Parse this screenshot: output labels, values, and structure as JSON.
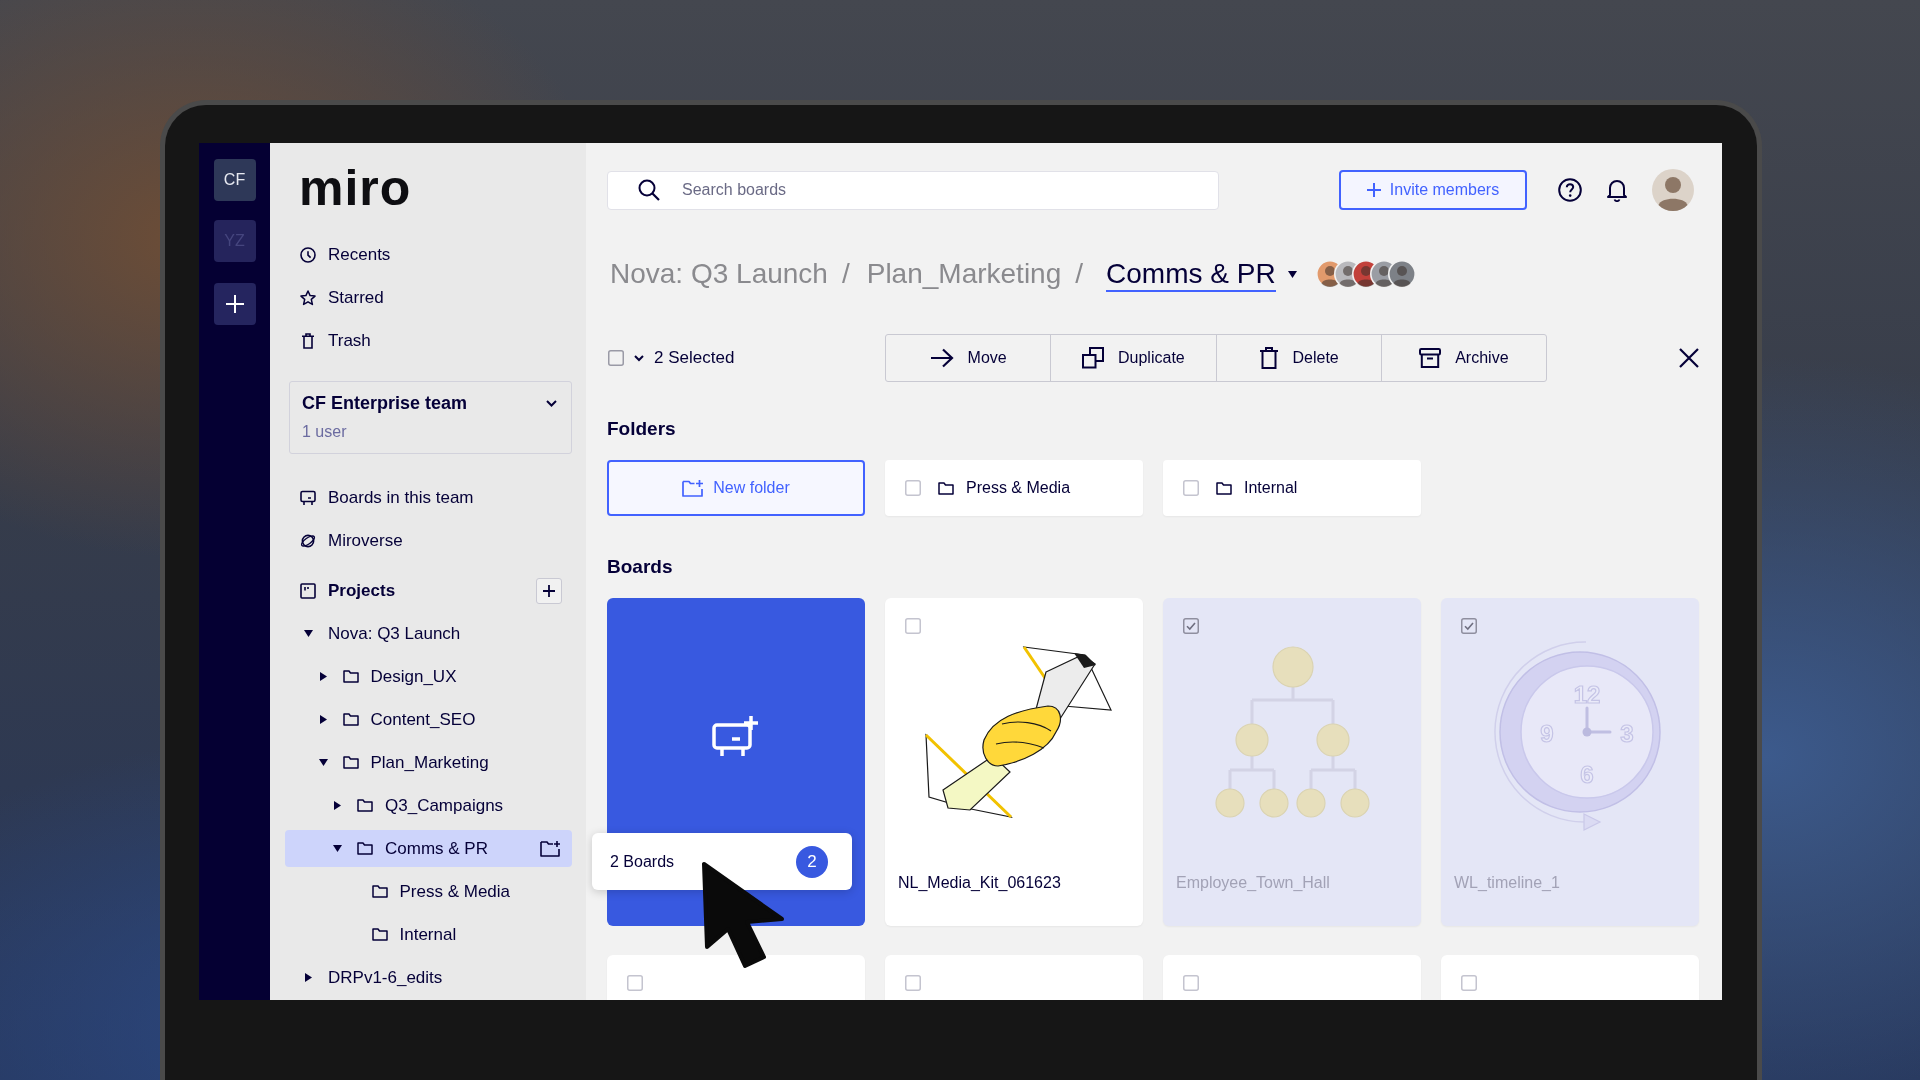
{
  "team_rail": {
    "teams": [
      {
        "initials": "CF",
        "selected": true
      },
      {
        "initials": "YZ",
        "selected": false
      }
    ]
  },
  "sidebar": {
    "logo": "miro",
    "nav": [
      {
        "label": "Recents"
      },
      {
        "label": "Starred"
      },
      {
        "label": "Trash"
      }
    ],
    "team": {
      "name": "CF Enterprise team",
      "members": "1 user"
    },
    "team_nav": [
      {
        "label": "Boards in this team"
      },
      {
        "label": "Miroverse"
      }
    ],
    "projects_heading": "Projects",
    "projects": [
      {
        "label": "Nova: Q3 Launch",
        "expanded": true,
        "selected": false,
        "children": [
          {
            "label": "Design_UX",
            "expanded": false,
            "selected": false
          },
          {
            "label": "Content_SEO",
            "expanded": false,
            "selected": false
          },
          {
            "label": "Plan_Marketing",
            "expanded": true,
            "selected": false,
            "children": [
              {
                "label": "Q3_Campaigns",
                "expanded": false,
                "selected": false
              },
              {
                "label": "Comms & PR",
                "expanded": true,
                "selected": true,
                "children": [
                  {
                    "label": "Press & Media",
                    "selected": false
                  },
                  {
                    "label": "Internal",
                    "selected": false
                  }
                ]
              }
            ]
          }
        ]
      },
      {
        "label": "DRPv1-6_edits",
        "expanded": false,
        "selected": false
      }
    ]
  },
  "topbar": {
    "search": {
      "placeholder": "Search boards"
    },
    "invite_button": "Invite members"
  },
  "breadcrumb": {
    "items": [
      {
        "label": "Nova: Q3 Launch",
        "separator": "/"
      },
      {
        "label": "Plan_Marketing",
        "separator": "/"
      }
    ],
    "current": "Comms & PR"
  },
  "selection_bar": {
    "select_all": {
      "checked": false
    },
    "count": "2 Selected",
    "actions": [
      {
        "label": "Move"
      },
      {
        "label": "Duplicate"
      },
      {
        "label": "Delete"
      },
      {
        "label": "Archive"
      }
    ]
  },
  "folders": {
    "heading": "Folders",
    "new_folder": "New folder",
    "items": [
      {
        "name": "Press & Media",
        "selected": false
      },
      {
        "name": "Internal",
        "selected": false
      }
    ]
  },
  "boards": {
    "heading": "Boards",
    "items": [
      {
        "kind": "new"
      },
      {
        "kind": "board",
        "title": "NL_Media_Kit_061623",
        "selected": false
      },
      {
        "kind": "board",
        "title": "Employee_Town_Hall",
        "selected": true
      },
      {
        "kind": "board",
        "title": "WL_timeline_1",
        "selected": true,
        "thumbnail_text": [
          "12",
          "3",
          "6",
          "9"
        ]
      },
      {
        "kind": "board",
        "selected": false
      },
      {
        "kind": "board",
        "selected": false
      },
      {
        "kind": "board",
        "selected": false
      },
      {
        "kind": "board",
        "selected": false
      }
    ]
  },
  "drag_preview": {
    "label": "2 Boards",
    "count": "2"
  }
}
